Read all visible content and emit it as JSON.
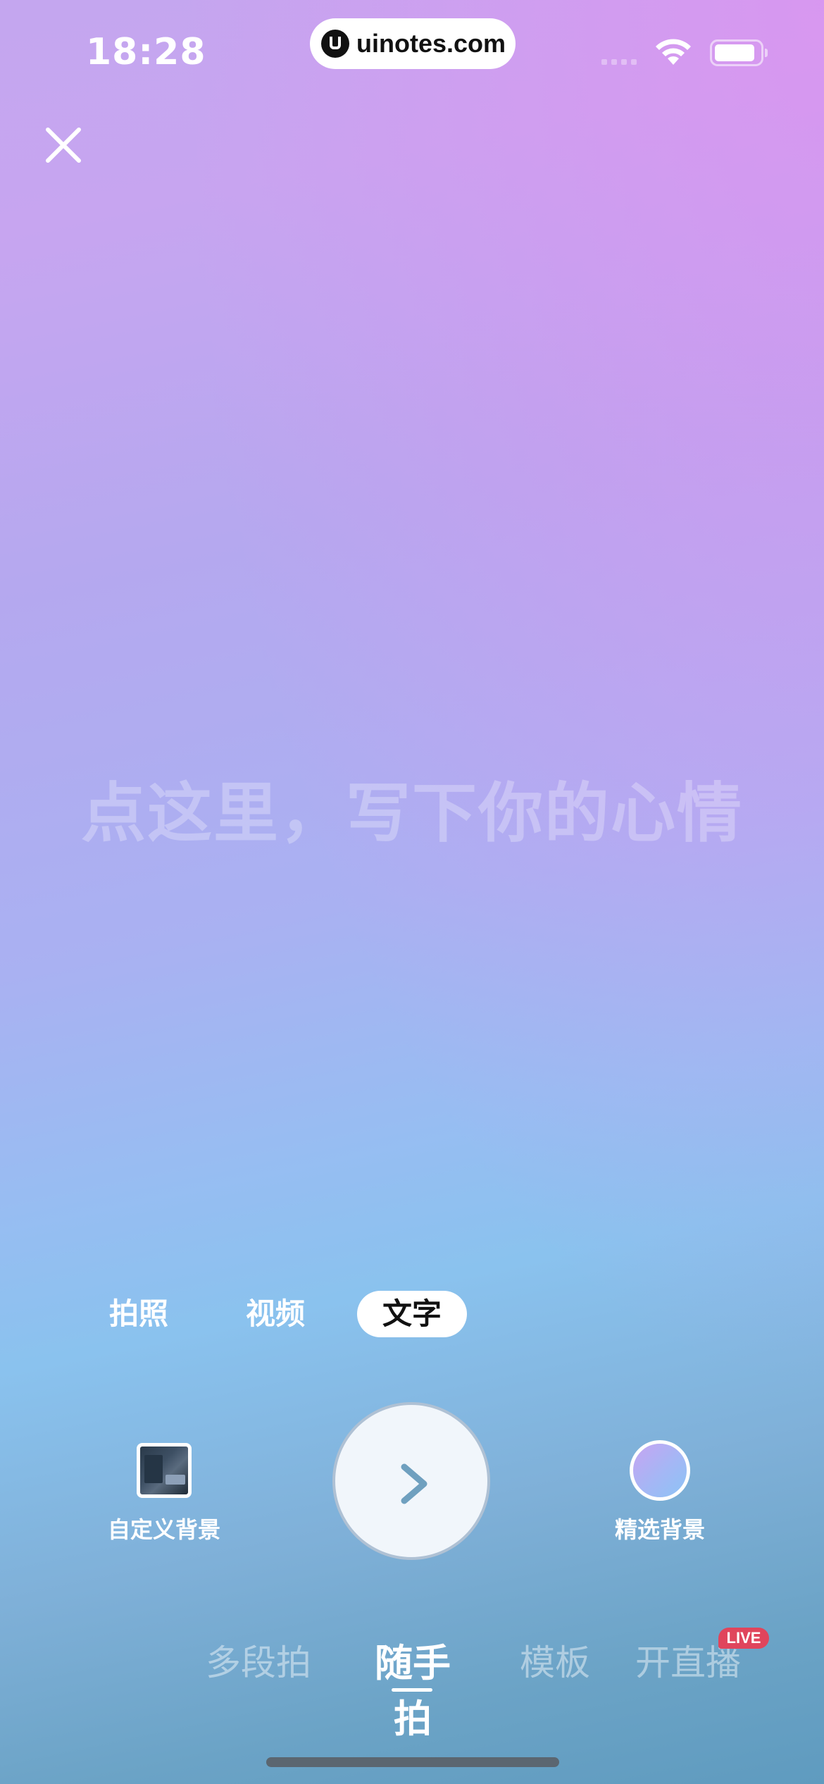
{
  "status_bar": {
    "time": "18:28",
    "watermark": "uinotes.com",
    "wifi_icon": "wifi-icon",
    "battery_icon": "battery-icon"
  },
  "close_icon": "close-icon",
  "editor": {
    "placeholder": "点这里，写下你的心情"
  },
  "mode_tabs": {
    "photo": "拍照",
    "video": "视频",
    "text": "文字",
    "selected": "文字"
  },
  "controls": {
    "custom_background_label": "自定义背景",
    "featured_background_label": "精选背景",
    "next_icon": "chevron-right-icon"
  },
  "capture_tabs": {
    "multi_segment": "多段拍",
    "casual": "随手拍",
    "template": "模板",
    "go_live": "开直播",
    "live_badge": "LIVE",
    "selected": "随手拍"
  },
  "colors": {
    "live_badge": "#e0455c",
    "gradient_top": "#c4a6ef",
    "gradient_bottom": "#5f9bbf"
  }
}
